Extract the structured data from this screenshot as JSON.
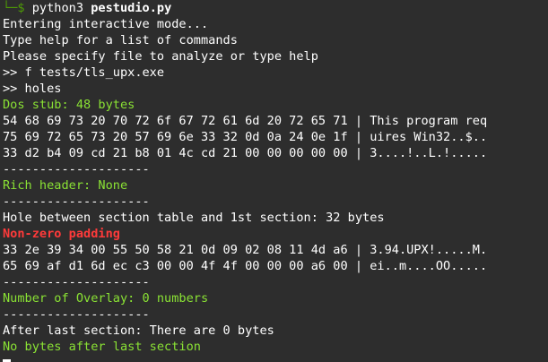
{
  "prompt": {
    "corner": "└─$",
    "command_base": "python3",
    "command_arg": "pestudio.py"
  },
  "lines": [
    {
      "text": "Entering interactive mode...",
      "color": "white"
    },
    {
      "text": "Type help for a list of commands",
      "color": "white"
    },
    {
      "text": "Please specify file to analyze or type help",
      "color": "white"
    },
    {
      "text": ">> f tests/tls_upx.exe",
      "color": "white"
    },
    {
      "text": ">> holes",
      "color": "white"
    },
    {
      "text": "Dos stub: 48 bytes",
      "color": "green"
    },
    {
      "text": "54 68 69 73 20 70 72 6f 67 72 61 6d 20 72 65 71 | This program req",
      "color": "white"
    },
    {
      "text": "75 69 72 65 73 20 57 69 6e 33 32 0d 0a 24 0e 1f | uires Win32..$..",
      "color": "white"
    },
    {
      "text": "33 d2 b4 09 cd 21 b8 01 4c cd 21 00 00 00 00 00 | 3....!..L.!.....",
      "color": "white"
    },
    {
      "text": "--------------------",
      "color": "white"
    },
    {
      "text": "Rich header: None",
      "color": "green"
    },
    {
      "text": "--------------------",
      "color": "white"
    },
    {
      "text": "Hole between section table and 1st section: 32 bytes",
      "color": "white"
    },
    {
      "text": "Non-zero padding",
      "color": "red"
    },
    {
      "text": "33 2e 39 34 00 55 50 58 21 0d 09 02 08 11 4d a6 | 3.94.UPX!.....M.",
      "color": "white"
    },
    {
      "text": "65 69 af d1 6d ec c3 00 00 4f 4f 00 00 00 a6 00 | ei..m....OO.....",
      "color": "white"
    },
    {
      "text": "--------------------",
      "color": "white"
    },
    {
      "text": "Number of Overlay: 0 numbers",
      "color": "green"
    },
    {
      "text": "--------------------",
      "color": "white"
    },
    {
      "text": "After last section: There are 0 bytes",
      "color": "white"
    },
    {
      "text": "No bytes after last section",
      "color": "green"
    }
  ]
}
